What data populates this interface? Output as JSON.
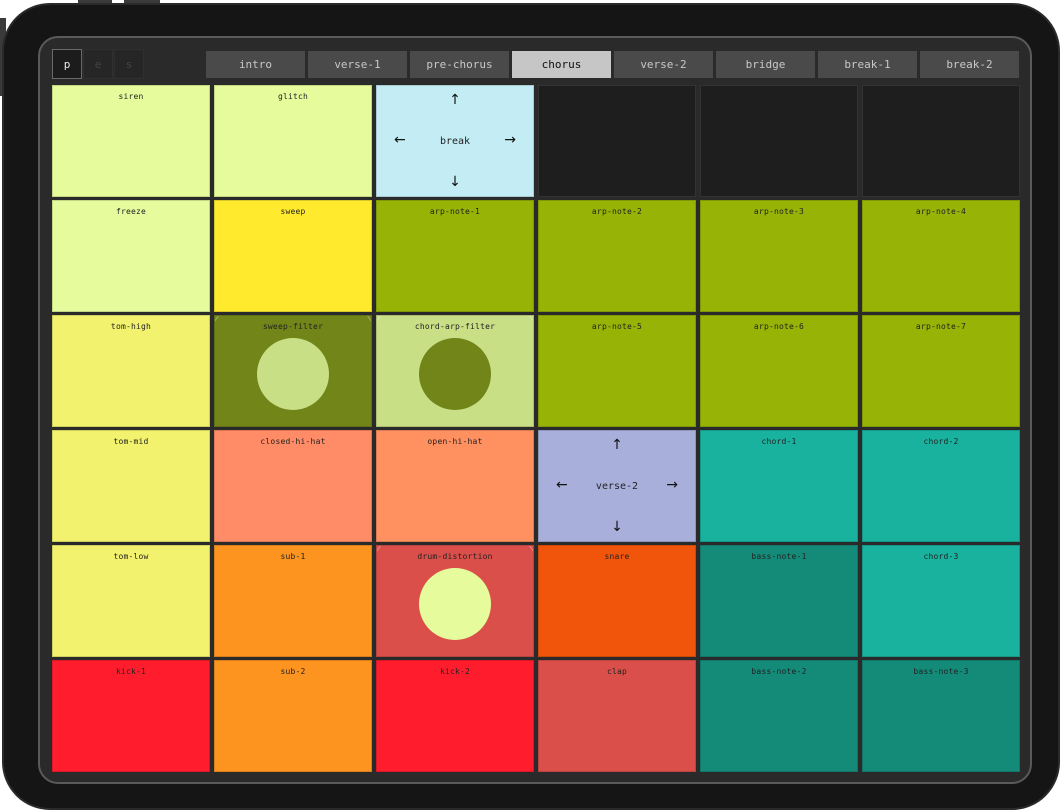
{
  "modes": [
    "p",
    "e",
    "s"
  ],
  "scenes": [
    "intro",
    "verse-1",
    "pre-chorus",
    "chorus",
    "verse-2",
    "bridge",
    "break-1",
    "break-2"
  ],
  "active_scene": "chorus",
  "colors": {
    "pale_lime": "#e6fc9c",
    "yellow": "#ffea2e",
    "olive": "#97b305",
    "olive_dark": "#718519",
    "pale_olive": "#c8df85",
    "pale_yellow": "#f2f26e",
    "salmon": "#ff8c66",
    "peach": "#ff9060",
    "orange": "#fd9420",
    "red": "#ff1c2d",
    "coral_red": "#db4f4a",
    "red_orange": "#f0550b",
    "teal": "#18b29e",
    "teal_dark": "#148a79",
    "light_blue": "#c3ecf4",
    "lavender": "#a8afdb",
    "empty": "#1e1e1e"
  },
  "pads": [
    {
      "label": "siren",
      "type": "pad",
      "color": "#e6fc9c"
    },
    {
      "label": "glitch",
      "type": "pad",
      "color": "#e6fc9c"
    },
    {
      "label": "break",
      "type": "nav",
      "color": "#c3ecf4"
    },
    {
      "label": "",
      "type": "empty",
      "color": "#1e1e1e"
    },
    {
      "label": "",
      "type": "empty",
      "color": "#1e1e1e"
    },
    {
      "label": "",
      "type": "empty",
      "color": "#1e1e1e"
    },
    {
      "label": "freeze",
      "type": "pad",
      "color": "#e6fc9c"
    },
    {
      "label": "sweep",
      "type": "pad",
      "color": "#ffea2e"
    },
    {
      "label": "arp-note-1",
      "type": "pad",
      "color": "#97b305"
    },
    {
      "label": "arp-note-2",
      "type": "pad",
      "color": "#97b305"
    },
    {
      "label": "arp-note-3",
      "type": "pad",
      "color": "#97b305"
    },
    {
      "label": "arp-note-4",
      "type": "pad",
      "color": "#97b305"
    },
    {
      "label": "tom-high",
      "type": "pad",
      "color": "#f2f26e"
    },
    {
      "label": "sweep-filter",
      "type": "knob",
      "color": "#718519",
      "knob_color": "#c8df85"
    },
    {
      "label": "chord-arp-filter",
      "type": "knob",
      "color": "#c8df85",
      "knob_color": "#718519"
    },
    {
      "label": "arp-note-5",
      "type": "pad",
      "color": "#97b305"
    },
    {
      "label": "arp-note-6",
      "type": "pad",
      "color": "#97b305"
    },
    {
      "label": "arp-note-7",
      "type": "pad",
      "color": "#97b305"
    },
    {
      "label": "tom-mid",
      "type": "pad",
      "color": "#f2f26e"
    },
    {
      "label": "closed-hi-hat",
      "type": "pad",
      "color": "#ff8c66"
    },
    {
      "label": "open-hi-hat",
      "type": "pad",
      "color": "#ff9060"
    },
    {
      "label": "verse-2",
      "type": "nav",
      "color": "#a8afdb"
    },
    {
      "label": "chord-1",
      "type": "pad",
      "color": "#18b29e"
    },
    {
      "label": "chord-2",
      "type": "pad",
      "color": "#18b29e"
    },
    {
      "label": "tom-low",
      "type": "pad",
      "color": "#f2f26e"
    },
    {
      "label": "sub-1",
      "type": "pad",
      "color": "#fd9420"
    },
    {
      "label": "drum-distortion",
      "type": "knob",
      "color": "#db4f4a",
      "knob_color": "#e6fc9c"
    },
    {
      "label": "snare",
      "type": "pad",
      "color": "#f0550b"
    },
    {
      "label": "bass-note-1",
      "type": "pad",
      "color": "#148a79"
    },
    {
      "label": "chord-3",
      "type": "pad",
      "color": "#18b29e"
    },
    {
      "label": "kick-1",
      "type": "pad",
      "color": "#ff1c2d"
    },
    {
      "label": "sub-2",
      "type": "pad",
      "color": "#fd9420"
    },
    {
      "label": "kick-2",
      "type": "pad",
      "color": "#ff1c2d"
    },
    {
      "label": "clap",
      "type": "pad",
      "color": "#db4f4a"
    },
    {
      "label": "bass-note-2",
      "type": "pad",
      "color": "#148a79"
    },
    {
      "label": "bass-note-3",
      "type": "pad",
      "color": "#148a79"
    }
  ],
  "nav_arrows": {
    "up": "↑",
    "down": "↓",
    "left": "←",
    "right": "→"
  }
}
